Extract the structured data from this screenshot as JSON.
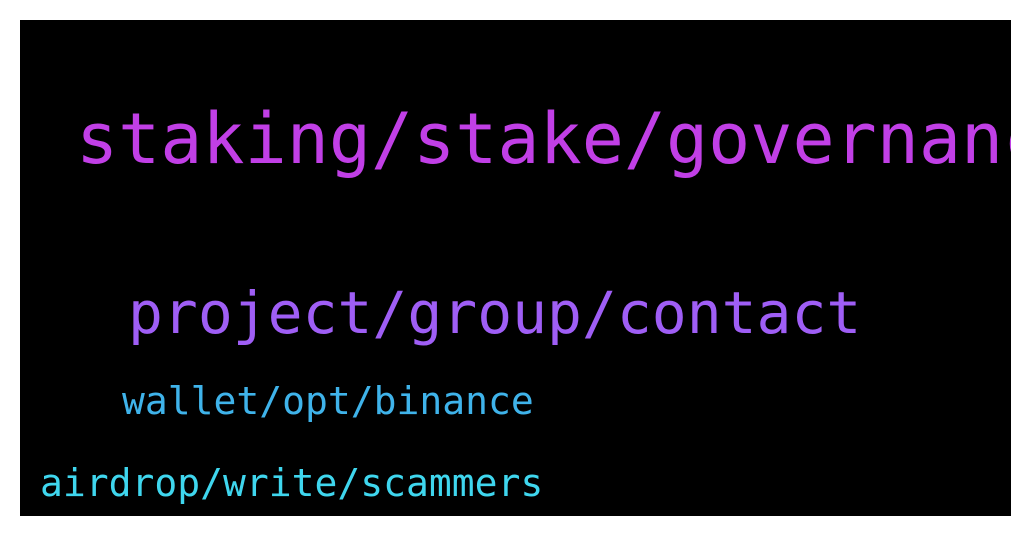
{
  "word_cloud": {
    "terms": [
      {
        "text": "staking/stake/governance",
        "color": "#c13fe6"
      },
      {
        "text": "project/group/contact",
        "color": "#9f5ef5"
      },
      {
        "text": "wallet/opt/binance",
        "color": "#3fb3ea"
      },
      {
        "text": "airdrop/write/scammers",
        "color": "#3fd6ee"
      }
    ]
  }
}
